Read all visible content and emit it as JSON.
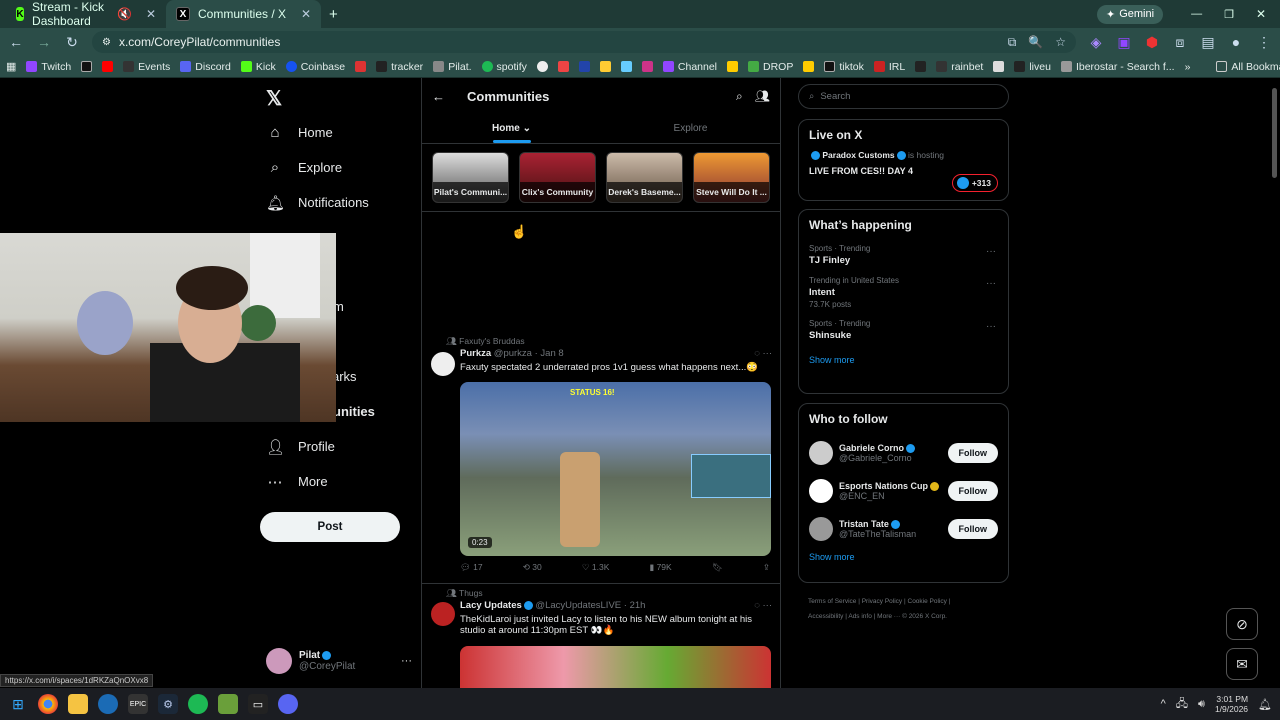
{
  "browser": {
    "tabs": [
      {
        "label": "Stream - Kick Dashboard"
      },
      {
        "label": "Communities / X"
      }
    ],
    "new_tab": "+",
    "gemini": "Gemini",
    "url": "x.com/CoreyPilat/communities",
    "bookmarks": [
      "Twitch",
      "Kick",
      "Events",
      "Discord",
      "Coinbase",
      "tracker",
      "Pilat.",
      "spotify",
      "Channel",
      "DROP",
      "tiktok",
      "IRL",
      "rainbet",
      "liveu",
      "Iberostar - Search f...",
      "All Bookmarks"
    ],
    "status_url": "https://x.com/i/spaces/1dRKZaQnOXvx8"
  },
  "sidebar": {
    "items": [
      {
        "label": "Home"
      },
      {
        "label": "Explore"
      },
      {
        "label": "Notifications"
      },
      {
        "label": "m"
      },
      {
        "label": "arks"
      },
      {
        "label": "unities"
      },
      {
        "label": "Profile"
      },
      {
        "label": "More"
      }
    ],
    "post": "Post",
    "account": {
      "name": "Pilat",
      "handle": "@CoreyPilat"
    }
  },
  "main": {
    "title": "Communities",
    "tabs": [
      {
        "label": "Home"
      },
      {
        "label": "Explore"
      }
    ],
    "communities": [
      "Pilat's Communi...",
      "Clix's Community",
      "Derek's Baseme...",
      "Steve Will Do It ..."
    ],
    "posts": [
      {
        "community": "Faxuty's Bruddas",
        "author": "Purkza",
        "handle": "@purkza",
        "time": "Jan 8",
        "text": "Faxuty spectated 2 underrated pros 1v1 guess what happens next...😳",
        "video_time": "0:23",
        "overlay": "STATUS 16!",
        "replies": "17",
        "reposts": "30",
        "likes": "1.3K",
        "views": "79K"
      },
      {
        "community": "Thugs",
        "author": "Lacy Updates",
        "handle": "@LacyUpdatesLIVE",
        "time": "21h",
        "text": "TheKidLaroi just invited Lacy to listen to his NEW album tonight at his studio at around 11:30pm EST 👀🔥"
      }
    ]
  },
  "right": {
    "search_placeholder": "Search",
    "live": {
      "title": "Live on X",
      "host": "Paradox Customs",
      "hosting": "is hosting",
      "stream": "LIVE FROM CES!! DAY 4",
      "count": "+313"
    },
    "happening": {
      "title": "What’s happening",
      "trends": [
        {
          "sub": "Sports · Trending",
          "name": "TJ Finley",
          "posts": ""
        },
        {
          "sub": "Trending in United States",
          "name": "Intent",
          "posts": "73.7K posts"
        },
        {
          "sub": "Sports · Trending",
          "name": "Shinsuke",
          "posts": ""
        }
      ],
      "show_more": "Show more"
    },
    "who": {
      "title": "Who to follow",
      "users": [
        {
          "name": "Gabriele Corno",
          "handle": "@Gabriele_Corno",
          "btn": "Follow"
        },
        {
          "name": "Esports Nations Cup",
          "handle": "@ENC_EN",
          "btn": "Follow"
        },
        {
          "name": "Tristan Tate",
          "handle": "@TateTheTalisman",
          "btn": "Follow"
        }
      ],
      "show_more": "Show more"
    },
    "footer": [
      "Terms of Service",
      "Privacy Policy",
      "Cookie Policy",
      "Accessibility",
      "Ads info",
      "More ···",
      "© 2026 X Corp."
    ]
  },
  "taskbar": {
    "time": "3:01 PM",
    "date": "1/9/2026"
  },
  "colors": {
    "accent": "#1d9bf0",
    "chrome": "#2b4d48",
    "bg": "#000000"
  }
}
